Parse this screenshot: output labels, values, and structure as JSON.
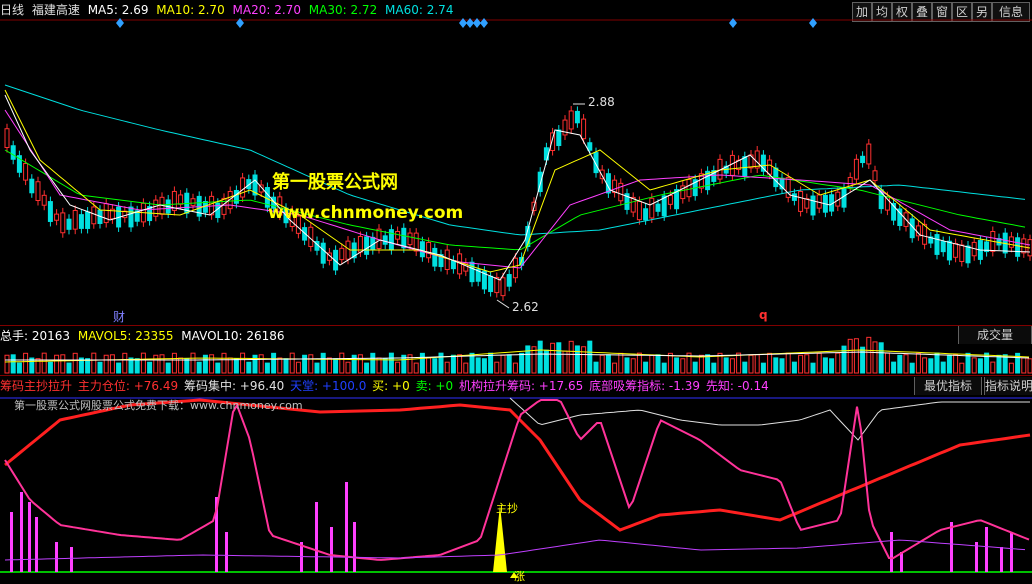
{
  "header": {
    "period": "日线",
    "stock_name": "福建高速",
    "ma_labels": [
      {
        "text": "MA5: 2.69",
        "color": "#ffffff"
      },
      {
        "text": "MA10: 2.70",
        "color": "#ffff00"
      },
      {
        "text": "MA20: 2.70",
        "color": "#ff40ff"
      },
      {
        "text": "MA30: 2.72",
        "color": "#00ff00"
      },
      {
        "text": "MA60: 2.74",
        "color": "#00e0e0"
      }
    ],
    "toolbar": [
      "加",
      "均",
      "权",
      "叠",
      "窗",
      "区",
      "另",
      "信息"
    ]
  },
  "price_panel": {
    "high_label": "2.88",
    "low_label": "2.62",
    "marker_cai": "财",
    "marker_q": "q",
    "watermark_title": "第一股票公式网",
    "watermark_url": "www.chnmoney.com"
  },
  "volume_panel": {
    "labels": [
      {
        "text": "总手: 20163",
        "color": "#ffffff"
      },
      {
        "text": "MAVOL5: 23355",
        "color": "#ffff00"
      },
      {
        "text": "MAVOL10: 26186",
        "color": "#ffffff"
      }
    ],
    "button": "成交量"
  },
  "indicator_panel": {
    "labels": [
      {
        "text": "筹码主抄拉升",
        "color": "#ff3030"
      },
      {
        "text": "主力仓位: +76.49",
        "color": "#ff3030"
      },
      {
        "text": "筹码集中: +96.40",
        "color": "#e0e0e0"
      },
      {
        "text": "天堂: +100.0",
        "color": "#2040ff"
      },
      {
        "text": "买: +0",
        "color": "#ffff00"
      },
      {
        "text": "卖: +0",
        "color": "#00ff00"
      },
      {
        "text": "机构拉升筹码: +17.65",
        "color": "#ff40ff"
      },
      {
        "text": "底部吸筹指标: -1.39",
        "color": "#ff40ff"
      },
      {
        "text": "先知: -0.14",
        "color": "#ff40ff"
      }
    ],
    "buttons": [
      "最优指标",
      "指标说明"
    ],
    "watermark": "第一股票公式网股票公式免费下载：www.chnmoney.com",
    "marker_zhuchao": "主抄",
    "marker_zhang": "涨"
  },
  "chart_data": {
    "type": "candlestick",
    "price_high": 2.88,
    "price_low": 2.62,
    "moving_averages": {
      "MA5": 2.69,
      "MA10": 2.7,
      "MA20": 2.7,
      "MA30": 2.72,
      "MA60": 2.74
    },
    "volume": {
      "total": 20163,
      "MAVOL5": 23355,
      "MAVOL10": 26186
    }
  }
}
